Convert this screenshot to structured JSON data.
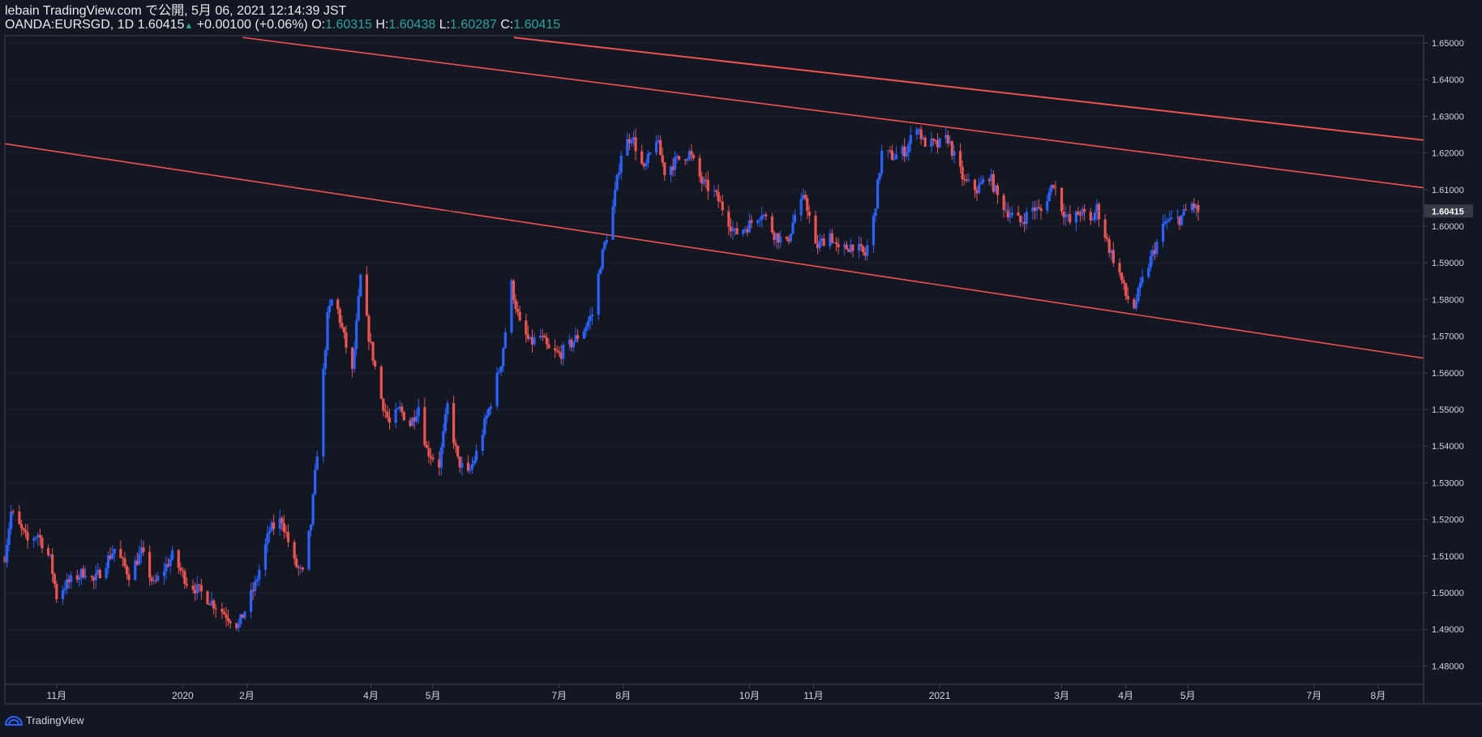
{
  "header": {
    "line1": "lebain TradingView.com で公開, 5月 06, 2021 12:14:39 JST",
    "symbol": "OANDA:EURSGD, 1D 1.60415",
    "change": "+0.00100 (+0.06%)",
    "o_label": "O:",
    "o_value": "1.60315",
    "h_label": "H:",
    "h_value": "1.60438",
    "l_label": "L:",
    "l_value": "1.60287",
    "c_label": "C:",
    "c_value": "1.60415"
  },
  "footer": {
    "brand": "TradingView"
  },
  "colors": {
    "background": "#131722",
    "up": "#2962ff",
    "down": "#ef5350",
    "trendline": "#ef5350",
    "text": "#d1d4dc",
    "ohlc_value": "#26a69a"
  },
  "chart_data": {
    "type": "candlestick",
    "symbol": "OANDA:EURSGD",
    "interval": "1D",
    "last_price": 1.60415,
    "ylim": [
      1.475,
      1.652
    ],
    "y_ticks": [
      "1.65000",
      "1.64000",
      "1.63000",
      "1.62000",
      "1.61000",
      "1.60000",
      "1.59000",
      "1.58000",
      "1.57000",
      "1.56000",
      "1.55000",
      "1.54000",
      "1.53000",
      "1.52000",
      "1.51000",
      "1.50000",
      "1.49000",
      "1.48000"
    ],
    "x_ticks": [
      {
        "label": "11月",
        "date": "2019-11-01"
      },
      {
        "label": "2020",
        "date": "2020-01-01"
      },
      {
        "label": "2月",
        "date": "2020-02-01"
      },
      {
        "label": "4月",
        "date": "2020-04-01"
      },
      {
        "label": "5月",
        "date": "2020-05-01"
      },
      {
        "label": "7月",
        "date": "2020-07-01"
      },
      {
        "label": "8月",
        "date": "2020-08-01"
      },
      {
        "label": "10月",
        "date": "2020-10-01"
      },
      {
        "label": "11月",
        "date": "2020-11-01"
      },
      {
        "label": "2021",
        "date": "2021-01-01"
      },
      {
        "label": "3月",
        "date": "2021-03-01"
      },
      {
        "label": "4月",
        "date": "2021-04-01"
      },
      {
        "label": "5月",
        "date": "2021-05-01"
      },
      {
        "label": "7月",
        "date": "2021-07-01"
      },
      {
        "label": "8月",
        "date": "2021-08-01"
      }
    ],
    "price_path": [
      [
        "2019-10-07",
        1.51
      ],
      [
        "2019-10-10",
        1.522
      ],
      [
        "2019-10-18",
        1.514
      ],
      [
        "2019-10-23",
        1.516
      ],
      [
        "2019-10-29",
        1.509
      ],
      [
        "2019-11-01",
        1.499
      ],
      [
        "2019-11-05",
        1.502
      ],
      [
        "2019-11-15",
        1.506
      ],
      [
        "2019-11-19",
        1.503
      ],
      [
        "2019-11-29",
        1.512
      ],
      [
        "2019-12-06",
        1.505
      ],
      [
        "2019-12-12",
        1.511
      ],
      [
        "2019-12-18",
        1.502
      ],
      [
        "2019-12-27",
        1.51
      ],
      [
        "2020-01-03",
        1.503
      ],
      [
        "2020-01-10",
        1.5
      ],
      [
        "2020-01-20",
        1.495
      ],
      [
        "2020-01-28",
        1.491
      ],
      [
        "2020-02-05",
        1.502
      ],
      [
        "2020-02-12",
        1.517
      ],
      [
        "2020-02-18",
        1.52
      ],
      [
        "2020-02-24",
        1.508
      ],
      [
        "2020-02-28",
        1.505
      ],
      [
        "2020-03-03",
        1.519
      ],
      [
        "2020-03-07",
        1.545
      ],
      [
        "2020-03-11",
        1.575
      ],
      [
        "2020-03-14",
        1.582
      ],
      [
        "2020-03-18",
        1.572
      ],
      [
        "2020-03-23",
        1.56
      ],
      [
        "2020-03-27",
        1.586
      ],
      [
        "2020-03-31",
        1.57
      ],
      [
        "2020-04-06",
        1.553
      ],
      [
        "2020-04-10",
        1.546
      ],
      [
        "2020-04-15",
        1.55
      ],
      [
        "2020-04-20",
        1.546
      ],
      [
        "2020-04-24",
        1.551
      ],
      [
        "2020-04-28",
        1.539
      ],
      [
        "2020-05-04",
        1.535
      ],
      [
        "2020-05-08",
        1.551
      ],
      [
        "2020-05-13",
        1.536
      ],
      [
        "2020-05-18",
        1.532
      ],
      [
        "2020-05-22",
        1.538
      ],
      [
        "2020-05-28",
        1.55
      ],
      [
        "2020-06-03",
        1.563
      ],
      [
        "2020-06-08",
        1.584
      ],
      [
        "2020-06-12",
        1.573
      ],
      [
        "2020-06-17",
        1.568
      ],
      [
        "2020-06-22",
        1.57
      ],
      [
        "2020-06-26",
        1.566
      ],
      [
        "2020-07-01",
        1.565
      ],
      [
        "2020-07-07",
        1.568
      ],
      [
        "2020-07-13",
        1.572
      ],
      [
        "2020-07-17",
        1.576
      ],
      [
        "2020-07-21",
        1.59
      ],
      [
        "2020-07-27",
        1.605
      ],
      [
        "2020-07-31",
        1.62
      ],
      [
        "2020-08-05",
        1.625
      ],
      [
        "2020-08-11",
        1.615
      ],
      [
        "2020-08-17",
        1.624
      ],
      [
        "2020-08-21",
        1.615
      ],
      [
        "2020-08-27",
        1.618
      ],
      [
        "2020-09-02",
        1.62
      ],
      [
        "2020-09-08",
        1.612
      ],
      [
        "2020-09-14",
        1.609
      ],
      [
        "2020-09-18",
        1.605
      ],
      [
        "2020-09-24",
        1.598
      ],
      [
        "2020-09-30",
        1.6
      ],
      [
        "2020-10-07",
        1.604
      ],
      [
        "2020-10-13",
        1.598
      ],
      [
        "2020-10-19",
        1.595
      ],
      [
        "2020-10-23",
        1.603
      ],
      [
        "2020-10-28",
        1.608
      ],
      [
        "2020-11-02",
        1.594
      ],
      [
        "2020-11-09",
        1.598
      ],
      [
        "2020-11-13",
        1.593
      ],
      [
        "2020-11-20",
        1.595
      ],
      [
        "2020-11-26",
        1.592
      ],
      [
        "2020-11-30",
        1.602
      ],
      [
        "2020-12-04",
        1.62
      ],
      [
        "2020-12-10",
        1.619
      ],
      [
        "2020-12-16",
        1.621
      ],
      [
        "2020-12-21",
        1.628
      ],
      [
        "2020-12-24",
        1.623
      ],
      [
        "2020-12-31",
        1.622
      ],
      [
        "2021-01-05",
        1.624
      ],
      [
        "2021-01-08",
        1.619
      ],
      [
        "2021-01-13",
        1.612
      ],
      [
        "2021-01-19",
        1.61
      ],
      [
        "2021-01-25",
        1.614
      ],
      [
        "2021-01-29",
        1.608
      ],
      [
        "2021-02-03",
        1.604
      ],
      [
        "2021-02-09",
        1.601
      ],
      [
        "2021-02-15",
        1.605
      ],
      [
        "2021-02-19",
        1.604
      ],
      [
        "2021-02-25",
        1.612
      ],
      [
        "2021-03-01",
        1.605
      ],
      [
        "2021-03-05",
        1.601
      ],
      [
        "2021-03-10",
        1.604
      ],
      [
        "2021-03-15",
        1.601
      ],
      [
        "2021-03-18",
        1.605
      ],
      [
        "2021-03-24",
        1.594
      ],
      [
        "2021-03-29",
        1.587
      ],
      [
        "2021-04-01",
        1.581
      ],
      [
        "2021-04-05",
        1.578
      ],
      [
        "2021-04-09",
        1.585
      ],
      [
        "2021-04-15",
        1.594
      ],
      [
        "2021-04-20",
        1.601
      ],
      [
        "2021-04-27",
        1.602
      ],
      [
        "2021-05-03",
        1.606
      ],
      [
        "2021-05-06",
        1.604
      ]
    ],
    "trendlines": [
      {
        "p1": [
          "2019-10-07",
          1.6225
        ],
        "p2": [
          "2021-08-23",
          1.564
        ]
      },
      {
        "p1": [
          "2020-01-30",
          1.6515
        ],
        "p2": [
          "2021-08-23",
          1.6105
        ]
      },
      {
        "p1": [
          "2020-06-09",
          1.6515
        ],
        "p2": [
          "2021-08-23",
          1.6235
        ]
      }
    ]
  }
}
